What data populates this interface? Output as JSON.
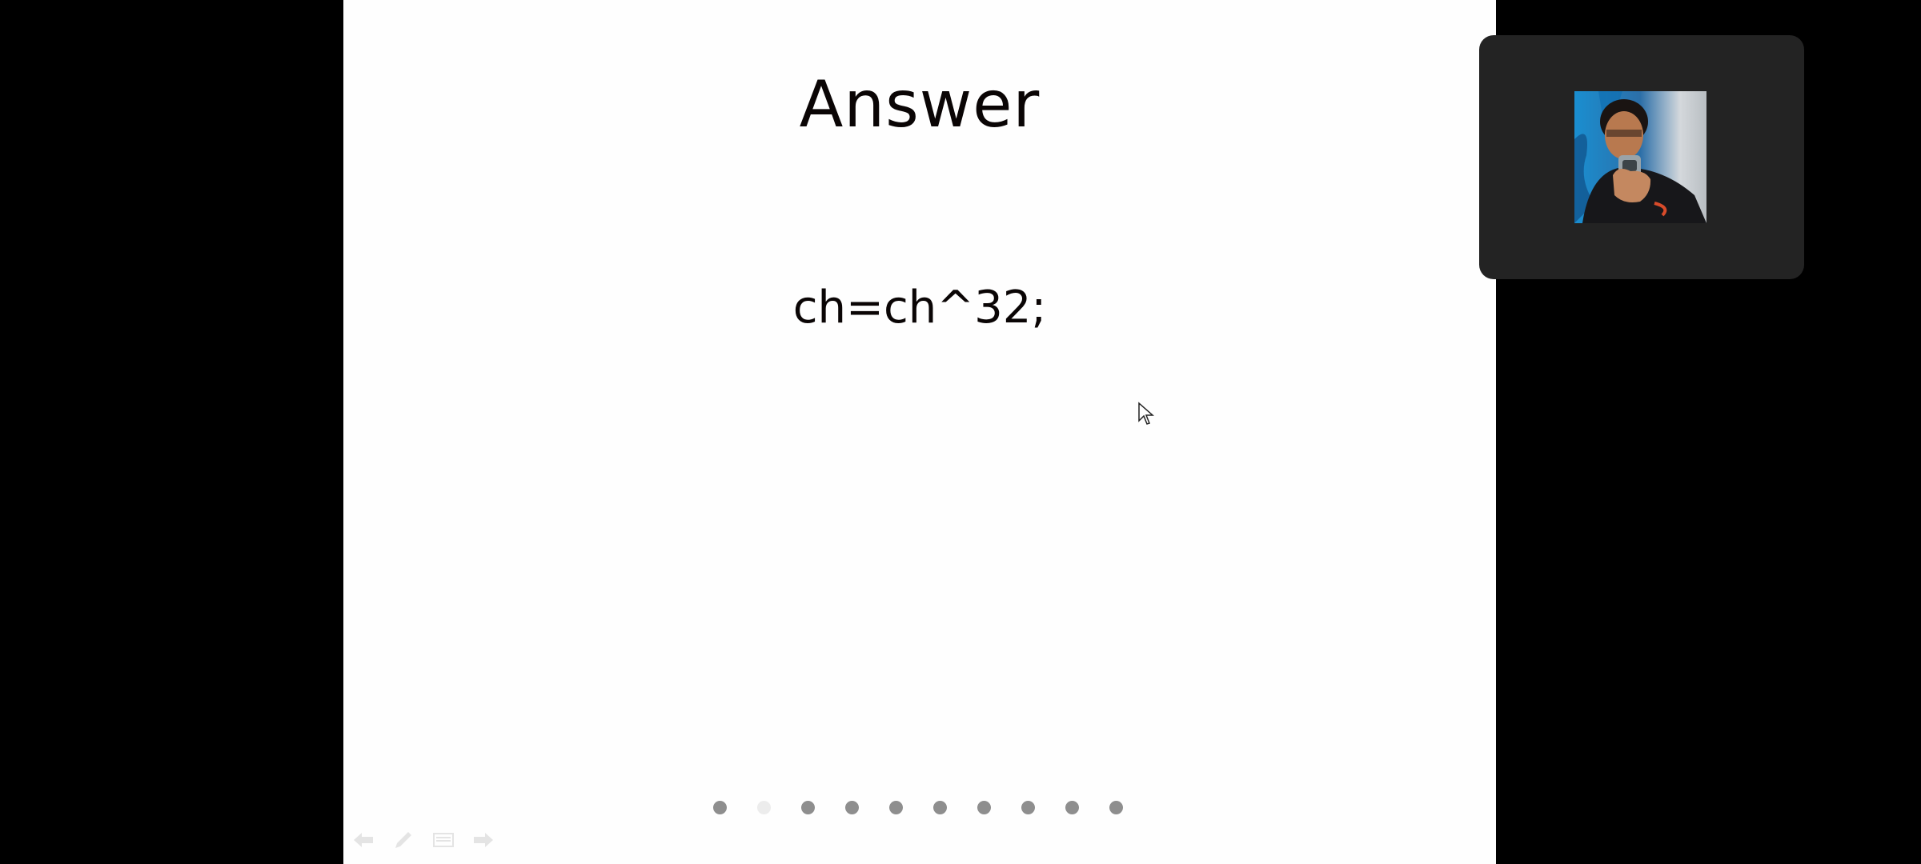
{
  "slide": {
    "title": "Answer",
    "body": "ch=ch^32;",
    "total_slides": 10,
    "current_slide": 2
  },
  "nav_dots": [
    {
      "state": "inactive"
    },
    {
      "state": "active"
    },
    {
      "state": "inactive"
    },
    {
      "state": "inactive"
    },
    {
      "state": "inactive"
    },
    {
      "state": "inactive"
    },
    {
      "state": "inactive"
    },
    {
      "state": "inactive"
    },
    {
      "state": "inactive"
    },
    {
      "state": "inactive"
    }
  ],
  "controls": [
    {
      "name": "previous-slide-button",
      "icon": "arrow-left-icon"
    },
    {
      "name": "pen-tool-button",
      "icon": "pen-icon"
    },
    {
      "name": "slide-menu-button",
      "icon": "menu-icon"
    },
    {
      "name": "next-slide-button",
      "icon": "arrow-right-icon"
    }
  ],
  "camera": {
    "participant_icon": "webcam-feed"
  },
  "colors": {
    "background": "#000000",
    "slide": "#fefefe",
    "text": "#0a0505",
    "dot": "#8e8e8e",
    "dot_active": "#ececec",
    "camera_panel": "#232323"
  }
}
